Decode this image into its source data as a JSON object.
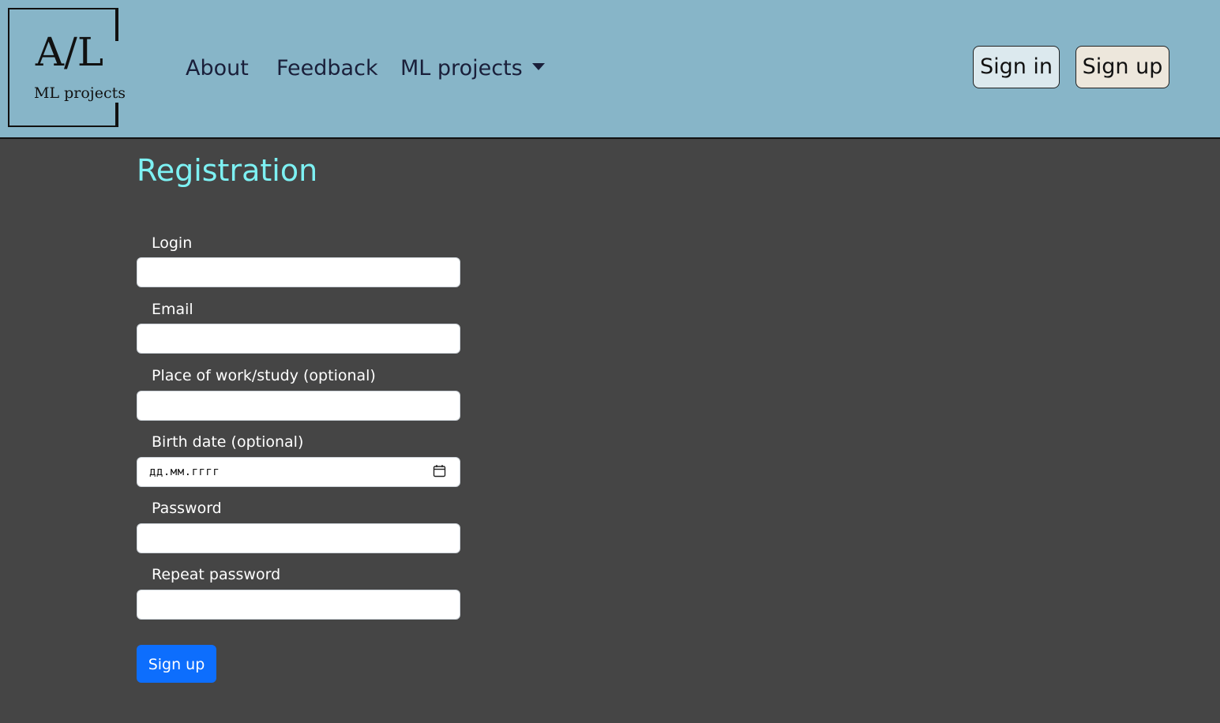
{
  "logo": {
    "main_text": "A/L",
    "sub_text": "ML projects"
  },
  "nav": {
    "items": [
      {
        "label": "About"
      },
      {
        "label": "Feedback"
      },
      {
        "label": "ML projects"
      }
    ],
    "signin_label": "Sign in",
    "signup_label": "Sign up"
  },
  "page": {
    "title": "Registration"
  },
  "form": {
    "login_label": "Login",
    "email_label": "Email",
    "work_label": "Place of work/study (optional)",
    "birth_label": "Birth date (optional)",
    "birth_placeholder": "дд.мм.гггг",
    "password_label": "Password",
    "repeat_label": "Repeat password",
    "submit_label": "Sign up"
  },
  "colors": {
    "navbar_bg": "#87b5c8",
    "page_bg": "#454545",
    "title": "#7df1f3",
    "primary_button": "#0d6efd"
  }
}
